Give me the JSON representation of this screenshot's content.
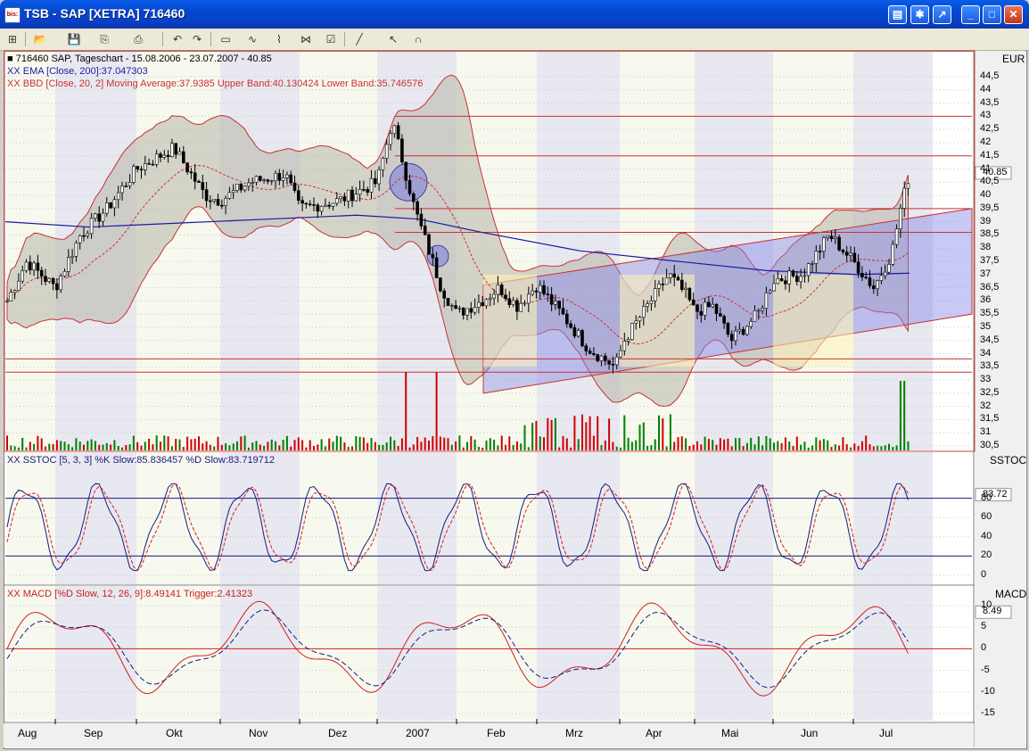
{
  "window": {
    "title": "TSB - SAP [XETRA] 716460",
    "icon_text": "bis:"
  },
  "toolbar": {
    "icons": [
      "new-icon",
      "open-icon",
      "save-icon",
      "copy-icon",
      "print-icon",
      "undo-icon",
      "redo-icon",
      "chart-type-icon",
      "indicator-icon",
      "study-icon",
      "drawing-icon",
      "properties-icon",
      "line-tool-icon",
      "cursor-icon",
      "magnet-icon"
    ]
  },
  "price_panel": {
    "header": "716460  SAP, Tageschart - 15.08.2006 - 23.07.2007 - 40.85",
    "ema_label": "XX EMA [Close, 200]:37.047303",
    "bbd_label": "XX BBD [Close, 20, 2] Moving Average:37.9385 Upper Band:40.130424 Lower Band:35.746576",
    "currency": "EUR",
    "last_price": "40.85",
    "y_ticks": [
      "44,5",
      "44",
      "43,5",
      "43",
      "42,5",
      "42",
      "41,5",
      "41",
      "40,5",
      "40",
      "39,5",
      "39",
      "38,5",
      "38",
      "37,5",
      "37",
      "36,5",
      "36",
      "35,5",
      "35",
      "34,5",
      "34",
      "33,5",
      "33",
      "32,5",
      "32",
      "31,5",
      "31",
      "30,5"
    ]
  },
  "stoch_panel": {
    "label": "XX SSTOC [5, 3, 3] %K Slow:85.836457 %D Slow:83.719712",
    "axis_title": "SSTOC",
    "last_value": "83.72",
    "y_ticks": [
      "80",
      "60",
      "40",
      "20",
      "0"
    ]
  },
  "macd_panel": {
    "label": "XX MACD [%D Slow, 12, 26, 9]:8.49141 Trigger:2.41323",
    "axis_title": "MACD",
    "last_value": "8.49",
    "y_ticks": [
      "10",
      "5",
      "0",
      "-5",
      "-10",
      "-15"
    ]
  },
  "x_axis": {
    "months": [
      "Aug",
      "Sep",
      "Okt",
      "Nov",
      "Dez",
      "2007",
      "Feb",
      "Mrz",
      "Apr",
      "Mai",
      "Jun",
      "Jul"
    ]
  },
  "colors": {
    "ema": "#1a1aa0",
    "band": "#c83232",
    "stoch_k": "#1a1a80",
    "stoch_d": "#d02020",
    "volume_up": "#008000",
    "volume_down": "#d00000"
  },
  "chart_data": {
    "type": "line",
    "title": "716460  SAP, Tageschart - 15.08.2006 - 23.07.2007 - 40.85",
    "x": [
      "2006-08",
      "2006-09",
      "2006-10",
      "2006-11",
      "2006-12",
      "2007-01",
      "2007-02",
      "2007-03",
      "2007-04",
      "2007-05",
      "2007-06",
      "2007-07"
    ],
    "series": [
      {
        "name": "Close",
        "values": [
          36.0,
          38.5,
          41.5,
          40.5,
          40.0,
          43.0,
          35.5,
          34.0,
          36.5,
          34.5,
          37.0,
          40.85
        ]
      },
      {
        "name": "EMA",
        "values": [
          39.0,
          38.8,
          38.9,
          39.1,
          39.2,
          39.3,
          38.6,
          37.9,
          37.5,
          37.2,
          37.0,
          37.05
        ]
      }
    ],
    "ylim": [
      30.5,
      44.5
    ]
  }
}
